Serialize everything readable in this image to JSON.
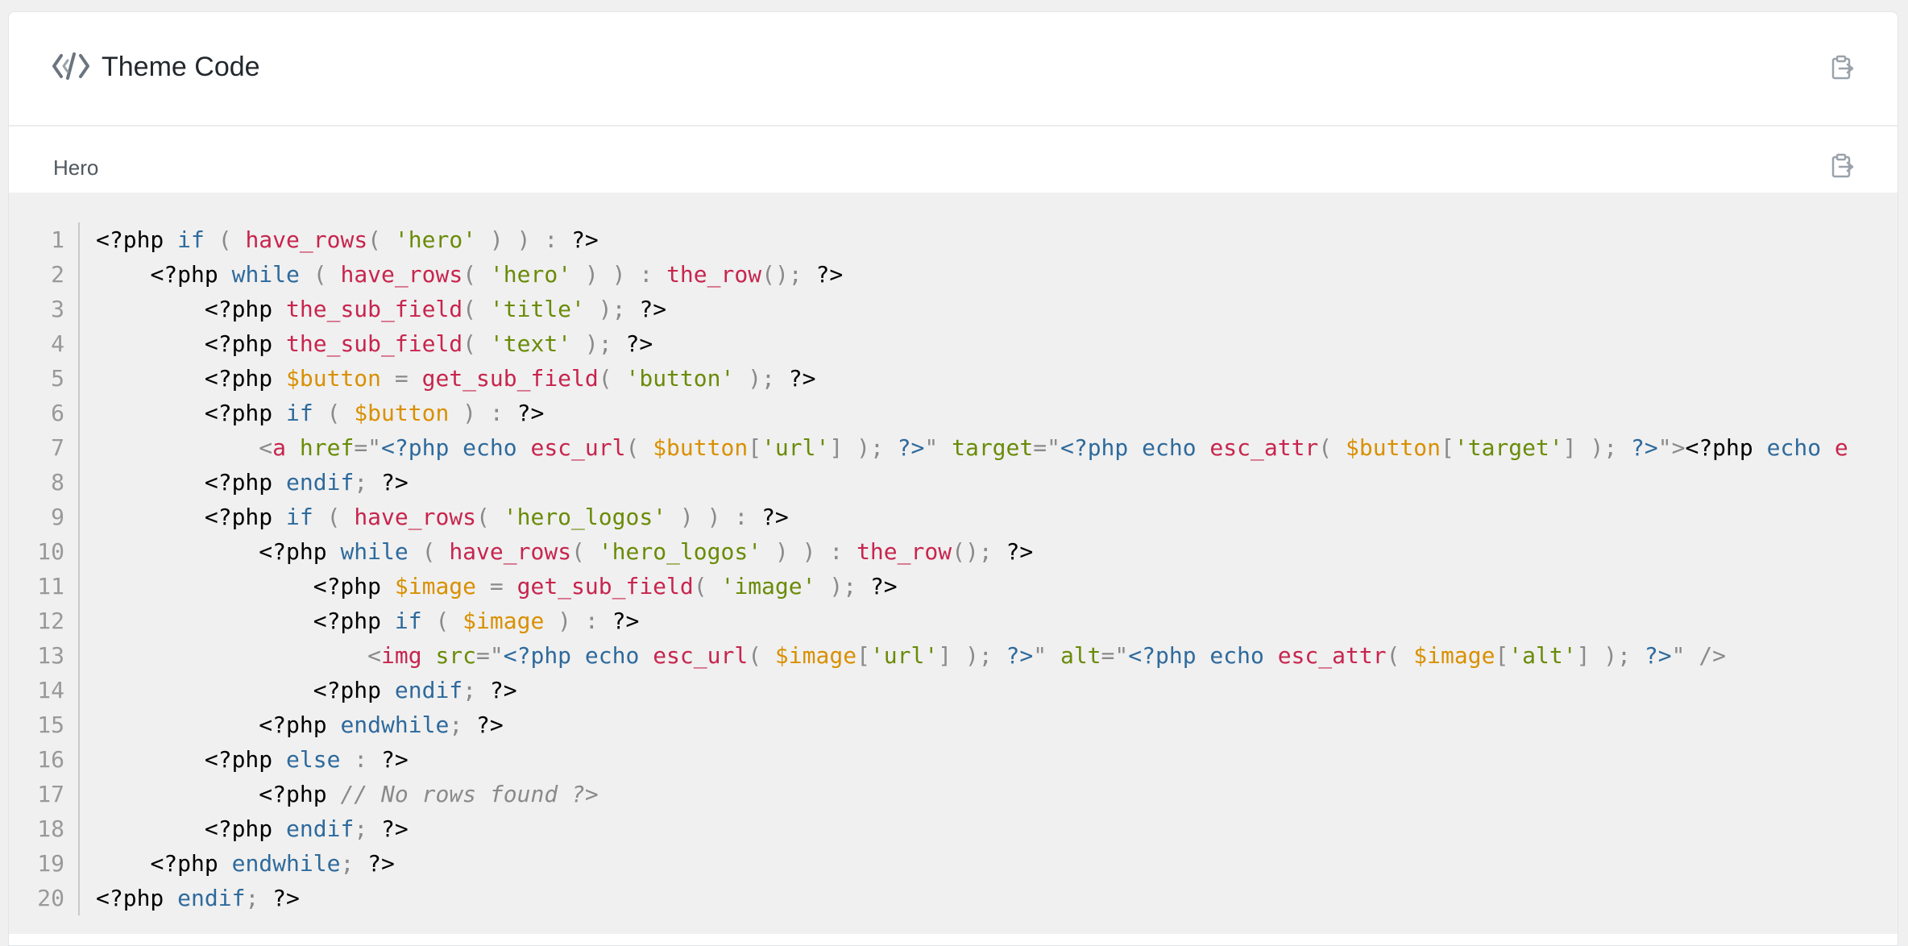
{
  "header": {
    "title": "Theme Code",
    "logo_icon": "code-brackets-icon",
    "copy_icon": "clipboard-copy-icon"
  },
  "section": {
    "title": "Hero",
    "copy_icon": "clipboard-copy-icon"
  },
  "code": {
    "lines": [
      {
        "n": "1",
        "indent": "",
        "tokens": [
          [
            "",
            "<?php "
          ],
          [
            "kw",
            "if"
          ],
          [
            "pn",
            " ( "
          ],
          [
            "fn",
            "have_rows"
          ],
          [
            "pn",
            "( "
          ],
          [
            "st",
            "'hero'"
          ],
          [
            "pn",
            " ) ) : "
          ],
          [
            "",
            "?>"
          ]
        ]
      },
      {
        "n": "2",
        "indent": "    ",
        "tokens": [
          [
            "",
            "<?php "
          ],
          [
            "kw",
            "while"
          ],
          [
            "pn",
            " ( "
          ],
          [
            "fn",
            "have_rows"
          ],
          [
            "pn",
            "( "
          ],
          [
            "st",
            "'hero'"
          ],
          [
            "pn",
            " ) ) : "
          ],
          [
            "fn",
            "the_row"
          ],
          [
            "pn",
            "(); "
          ],
          [
            "",
            "?>"
          ]
        ]
      },
      {
        "n": "3",
        "indent": "        ",
        "tokens": [
          [
            "",
            "<?php "
          ],
          [
            "fn",
            "the_sub_field"
          ],
          [
            "pn",
            "( "
          ],
          [
            "st",
            "'title'"
          ],
          [
            "pn",
            " ); "
          ],
          [
            "",
            "?>"
          ]
        ]
      },
      {
        "n": "4",
        "indent": "        ",
        "tokens": [
          [
            "",
            "<?php "
          ],
          [
            "fn",
            "the_sub_field"
          ],
          [
            "pn",
            "( "
          ],
          [
            "st",
            "'text'"
          ],
          [
            "pn",
            " ); "
          ],
          [
            "",
            "?>"
          ]
        ]
      },
      {
        "n": "5",
        "indent": "        ",
        "tokens": [
          [
            "",
            "<?php "
          ],
          [
            "vr",
            "$button"
          ],
          [
            "pn",
            " = "
          ],
          [
            "fn",
            "get_sub_field"
          ],
          [
            "pn",
            "( "
          ],
          [
            "st",
            "'button'"
          ],
          [
            "pn",
            " ); "
          ],
          [
            "",
            "?>"
          ]
        ]
      },
      {
        "n": "6",
        "indent": "        ",
        "tokens": [
          [
            "",
            "<?php "
          ],
          [
            "kw",
            "if"
          ],
          [
            "pn",
            " ( "
          ],
          [
            "vr",
            "$button"
          ],
          [
            "pn",
            " ) : "
          ],
          [
            "",
            "?>"
          ]
        ]
      },
      {
        "n": "7",
        "indent": "            ",
        "tokens": [
          [
            "pn",
            "<"
          ],
          [
            "tg",
            "a"
          ],
          [
            "",
            " "
          ],
          [
            "at",
            "href"
          ],
          [
            "pn",
            "=\""
          ],
          [
            "kw",
            "<?php echo "
          ],
          [
            "fn",
            "esc_url"
          ],
          [
            "pn",
            "( "
          ],
          [
            "vr",
            "$button"
          ],
          [
            "pn",
            "["
          ],
          [
            "st",
            "'url'"
          ],
          [
            "pn",
            "] ); "
          ],
          [
            "kw",
            "?>"
          ],
          [
            "pn",
            "\""
          ],
          [
            "",
            " "
          ],
          [
            "at",
            "target"
          ],
          [
            "pn",
            "=\""
          ],
          [
            "kw",
            "<?php echo "
          ],
          [
            "fn",
            "esc_attr"
          ],
          [
            "pn",
            "( "
          ],
          [
            "vr",
            "$button"
          ],
          [
            "pn",
            "["
          ],
          [
            "st",
            "'target'"
          ],
          [
            "pn",
            "] ); "
          ],
          [
            "kw",
            "?>"
          ],
          [
            "pn",
            "\">"
          ],
          [
            "",
            "<?php "
          ],
          [
            "kw",
            "echo"
          ],
          [
            "",
            " "
          ],
          [
            "fn",
            "e"
          ]
        ]
      },
      {
        "n": "8",
        "indent": "        ",
        "tokens": [
          [
            "",
            "<?php "
          ],
          [
            "kw",
            "endif"
          ],
          [
            "pn",
            "; "
          ],
          [
            "",
            "?>"
          ]
        ]
      },
      {
        "n": "9",
        "indent": "        ",
        "tokens": [
          [
            "",
            "<?php "
          ],
          [
            "kw",
            "if"
          ],
          [
            "pn",
            " ( "
          ],
          [
            "fn",
            "have_rows"
          ],
          [
            "pn",
            "( "
          ],
          [
            "st",
            "'hero_logos'"
          ],
          [
            "pn",
            " ) ) : "
          ],
          [
            "",
            "?>"
          ]
        ]
      },
      {
        "n": "10",
        "indent": "            ",
        "tokens": [
          [
            "",
            "<?php "
          ],
          [
            "kw",
            "while"
          ],
          [
            "pn",
            " ( "
          ],
          [
            "fn",
            "have_rows"
          ],
          [
            "pn",
            "( "
          ],
          [
            "st",
            "'hero_logos'"
          ],
          [
            "pn",
            " ) ) : "
          ],
          [
            "fn",
            "the_row"
          ],
          [
            "pn",
            "(); "
          ],
          [
            "",
            "?>"
          ]
        ]
      },
      {
        "n": "11",
        "indent": "                ",
        "tokens": [
          [
            "",
            "<?php "
          ],
          [
            "vr",
            "$image"
          ],
          [
            "pn",
            " = "
          ],
          [
            "fn",
            "get_sub_field"
          ],
          [
            "pn",
            "( "
          ],
          [
            "st",
            "'image'"
          ],
          [
            "pn",
            " ); "
          ],
          [
            "",
            "?>"
          ]
        ]
      },
      {
        "n": "12",
        "indent": "                ",
        "tokens": [
          [
            "",
            "<?php "
          ],
          [
            "kw",
            "if"
          ],
          [
            "pn",
            " ( "
          ],
          [
            "vr",
            "$image"
          ],
          [
            "pn",
            " ) : "
          ],
          [
            "",
            "?>"
          ]
        ]
      },
      {
        "n": "13",
        "indent": "                    ",
        "tokens": [
          [
            "pn",
            "<"
          ],
          [
            "tg",
            "img"
          ],
          [
            "",
            " "
          ],
          [
            "at",
            "src"
          ],
          [
            "pn",
            "=\""
          ],
          [
            "kw",
            "<?php echo "
          ],
          [
            "fn",
            "esc_url"
          ],
          [
            "pn",
            "( "
          ],
          [
            "vr",
            "$image"
          ],
          [
            "pn",
            "["
          ],
          [
            "st",
            "'url'"
          ],
          [
            "pn",
            "] ); "
          ],
          [
            "kw",
            "?>"
          ],
          [
            "pn",
            "\""
          ],
          [
            "",
            " "
          ],
          [
            "at",
            "alt"
          ],
          [
            "pn",
            "=\""
          ],
          [
            "kw",
            "<?php echo "
          ],
          [
            "fn",
            "esc_attr"
          ],
          [
            "pn",
            "( "
          ],
          [
            "vr",
            "$image"
          ],
          [
            "pn",
            "["
          ],
          [
            "st",
            "'alt'"
          ],
          [
            "pn",
            "] ); "
          ],
          [
            "kw",
            "?>"
          ],
          [
            "pn",
            "\" />"
          ]
        ]
      },
      {
        "n": "14",
        "indent": "                ",
        "tokens": [
          [
            "",
            "<?php "
          ],
          [
            "kw",
            "endif"
          ],
          [
            "pn",
            "; "
          ],
          [
            "",
            "?>"
          ]
        ]
      },
      {
        "n": "15",
        "indent": "            ",
        "tokens": [
          [
            "",
            "<?php "
          ],
          [
            "kw",
            "endwhile"
          ],
          [
            "pn",
            "; "
          ],
          [
            "",
            "?>"
          ]
        ]
      },
      {
        "n": "16",
        "indent": "        ",
        "tokens": [
          [
            "",
            "<?php "
          ],
          [
            "kw",
            "else"
          ],
          [
            "pn",
            " : "
          ],
          [
            "",
            "?>"
          ]
        ]
      },
      {
        "n": "17",
        "indent": "            ",
        "tokens": [
          [
            "",
            "<?php "
          ],
          [
            "cm",
            "// No rows found ?>"
          ]
        ]
      },
      {
        "n": "18",
        "indent": "        ",
        "tokens": [
          [
            "",
            "<?php "
          ],
          [
            "kw",
            "endif"
          ],
          [
            "pn",
            "; "
          ],
          [
            "",
            "?>"
          ]
        ]
      },
      {
        "n": "19",
        "indent": "    ",
        "tokens": [
          [
            "",
            "<?php "
          ],
          [
            "kw",
            "endwhile"
          ],
          [
            "pn",
            "; "
          ],
          [
            "",
            "?>"
          ]
        ]
      },
      {
        "n": "20",
        "indent": "",
        "tokens": [
          [
            "",
            "<?php "
          ],
          [
            "kw",
            "endif"
          ],
          [
            "pn",
            "; "
          ],
          [
            "",
            "?>"
          ]
        ]
      }
    ]
  }
}
